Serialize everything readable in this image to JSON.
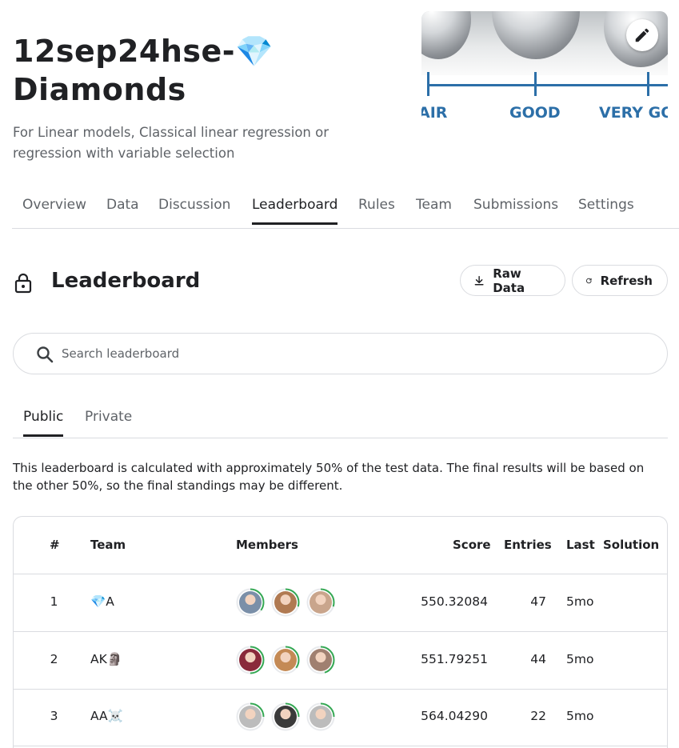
{
  "header": {
    "title": "12sep24hse-💎 Diamonds",
    "subtitle": "For Linear models, Classical linear regression or regression with variable selection"
  },
  "banner": {
    "labels": [
      "AIR",
      "GOOD",
      "VERY GO"
    ]
  },
  "nav": {
    "tabs": [
      "Overview",
      "Data",
      "Discussion",
      "Leaderboard",
      "Rules",
      "Team",
      "Submissions",
      "Settings"
    ],
    "active": "Leaderboard"
  },
  "leaderboard": {
    "title": "Leaderboard",
    "raw_data_label": "Raw Data",
    "refresh_label": "Refresh",
    "search_placeholder": "Search leaderboard",
    "subtabs": [
      "Public",
      "Private"
    ],
    "active_subtab": "Public",
    "notice": "This leaderboard is calculated with approximately 50% of the test data. The final results will be based on the other 50%, so the final standings may be different.",
    "columns": [
      "#",
      "Team",
      "Members",
      "Score",
      "Entries",
      "Last",
      "Solution"
    ],
    "rows": [
      {
        "rank": "1",
        "team": "💎A",
        "score": "550.32084",
        "entries": "47",
        "last": "5mo",
        "members": [
          {
            "avatar": "avatar-person-icon",
            "color": "#7a8fa8",
            "progress": 0.35
          },
          {
            "avatar": "avatar-person-icon",
            "color": "#b07a52",
            "progress": 0.3
          },
          {
            "avatar": "avatar-person-icon",
            "color": "#c9a58c",
            "progress": 0.3
          }
        ]
      },
      {
        "rank": "2",
        "team": "AK🗿",
        "score": "551.79251",
        "entries": "44",
        "last": "5mo",
        "members": [
          {
            "avatar": "avatar-person-icon",
            "color": "#8a2a3a",
            "progress": 0.5
          },
          {
            "avatar": "avatar-person-icon",
            "color": "#c48a55",
            "progress": 0.35
          },
          {
            "avatar": "avatar-person-icon",
            "color": "#a08070",
            "progress": 0.45
          }
        ]
      },
      {
        "rank": "3",
        "team": "AA☠️",
        "score": "564.04290",
        "entries": "22",
        "last": "5mo",
        "members": [
          {
            "avatar": "avatar-default-icon",
            "color": "#bcbcbc",
            "progress": 0.25
          },
          {
            "avatar": "avatar-person-icon",
            "color": "#3a3a3a",
            "progress": 0.25
          },
          {
            "avatar": "avatar-default-icon",
            "color": "#bcbcbc",
            "progress": 0.25
          }
        ]
      }
    ]
  },
  "colors": {
    "text": "#202124",
    "muted": "#5f6368",
    "border": "#dadce0",
    "ring_green": "#20beff",
    "ring_progress": "#34a853"
  }
}
